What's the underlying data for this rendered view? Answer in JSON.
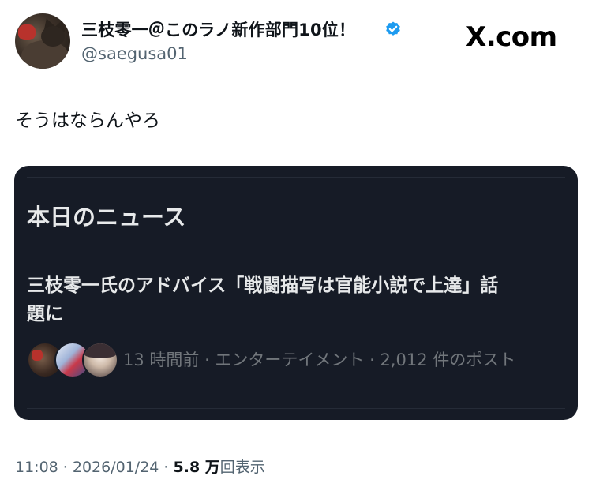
{
  "author": {
    "display_name": "三枝零一＠このラノ新作部門10位！",
    "handle": "@saegusa01",
    "verified_icon": "verified-badge-icon",
    "verified_color": "#1d9bf0"
  },
  "brand": {
    "label": "X.com"
  },
  "tweet": {
    "text": "そうはならんやろ"
  },
  "news_card": {
    "title": "本日のニュース",
    "headline": "三枝零一氏のアドバイス「戦闘描写は官能小説で上達」話題に",
    "meta": "13 時間前 · エンターテイメント · 2,012 件のポスト",
    "background": "#161b26"
  },
  "footer": {
    "time_date": "11:08 · 2026/01/24 · ",
    "views_count": "5.8 万",
    "views_label": "回表示"
  }
}
